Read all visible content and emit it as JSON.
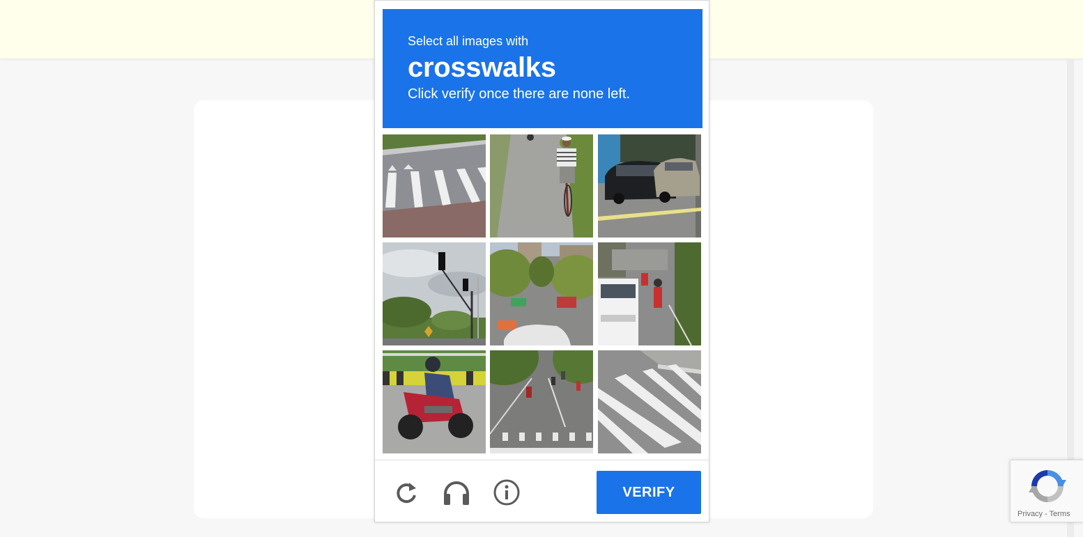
{
  "captcha": {
    "instruction_top": "Select all images with",
    "keyword": "crosswalks",
    "instruction_bottom": "Click verify once there are none left.",
    "verify_label": "VERIFY",
    "accent_color": "#1a73e8",
    "tiles": [
      {
        "subject": "crosswalk stripes on road"
      },
      {
        "subject": "man riding bicycle on road"
      },
      {
        "subject": "parked cars"
      },
      {
        "subject": "traffic lights against sky"
      },
      {
        "subject": "city street with cars and bus"
      },
      {
        "subject": "traffic with van and motorbikes"
      },
      {
        "subject": "person on motorcycle"
      },
      {
        "subject": "road with motorbikes and crosswalk"
      },
      {
        "subject": "crosswalk stripes on road"
      }
    ],
    "icons": [
      "reload-icon",
      "audio-headphones-icon",
      "info-icon"
    ]
  },
  "recaptcha_badge": {
    "privacy_label": "Privacy",
    "separator": "-",
    "terms_label": "Terms"
  },
  "page": {
    "banner_color": "#ffffec",
    "background_color": "#f7f7f7"
  }
}
